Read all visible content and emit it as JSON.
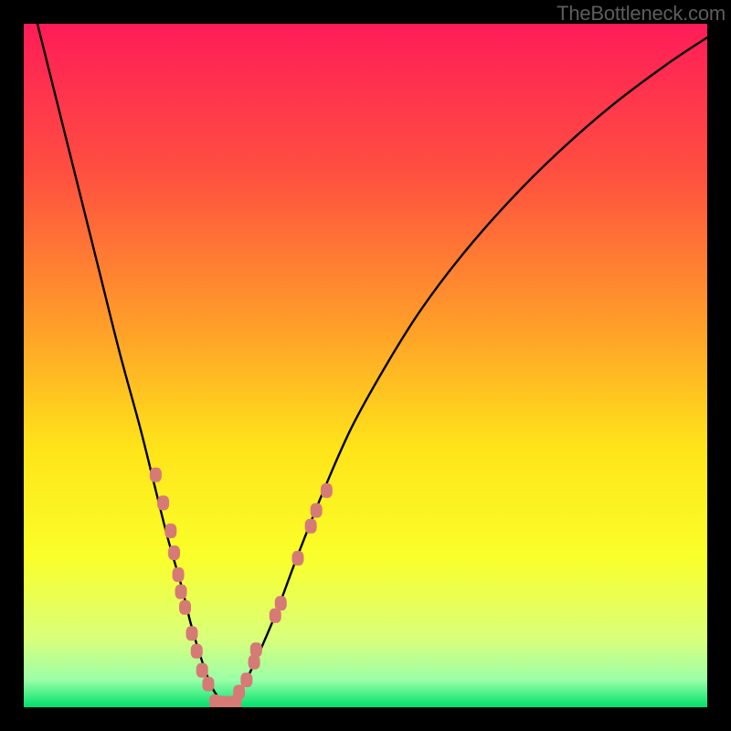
{
  "watermark": "TheBottleneck.com",
  "colors": {
    "frame": "#000000",
    "gradient_stops": [
      {
        "offset": 0.0,
        "color": "#ff1c58"
      },
      {
        "offset": 0.22,
        "color": "#ff5040"
      },
      {
        "offset": 0.45,
        "color": "#ffa128"
      },
      {
        "offset": 0.62,
        "color": "#ffe41a"
      },
      {
        "offset": 0.78,
        "color": "#faff2a"
      },
      {
        "offset": 0.9,
        "color": "#d9ff7b"
      },
      {
        "offset": 0.96,
        "color": "#9bffa8"
      },
      {
        "offset": 1.0,
        "color": "#00e06c"
      }
    ],
    "curve": "#000000",
    "marker": "#d67a76"
  },
  "chart_data": {
    "type": "line",
    "title": "",
    "xlabel": "",
    "ylabel": "",
    "xlim": [
      0,
      100
    ],
    "ylim": [
      0,
      100
    ],
    "grid": false,
    "series": [
      {
        "name": "bottleneck-curve",
        "x": [
          2,
          5,
          8,
          11,
          14,
          17,
          19,
          21,
          23,
          24.5,
          26,
          27.5,
          29,
          30.5,
          32,
          34,
          37,
          40,
          44,
          48,
          53,
          58,
          64,
          71,
          78,
          86,
          94,
          100
        ],
        "y": [
          100,
          88,
          76,
          64,
          52,
          41,
          33,
          25,
          18,
          12,
          7,
          3,
          1,
          1,
          3,
          7,
          14,
          22,
          32,
          41,
          50,
          58,
          66,
          74,
          81,
          88,
          94,
          98
        ]
      }
    ],
    "highlight_markers": {
      "name": "threshold-markers",
      "points": [
        {
          "x": 19.3,
          "y": 34.0
        },
        {
          "x": 20.4,
          "y": 29.9
        },
        {
          "x": 21.5,
          "y": 25.8
        },
        {
          "x": 22.0,
          "y": 22.6
        },
        {
          "x": 22.6,
          "y": 19.4
        },
        {
          "x": 23.0,
          "y": 16.9
        },
        {
          "x": 23.6,
          "y": 14.6
        },
        {
          "x": 24.6,
          "y": 10.8
        },
        {
          "x": 25.3,
          "y": 8.2
        },
        {
          "x": 26.1,
          "y": 5.4
        },
        {
          "x": 27.0,
          "y": 3.4
        },
        {
          "x": 28.0,
          "y": 0.8
        },
        {
          "x": 29.0,
          "y": 0.6
        },
        {
          "x": 30.0,
          "y": 0.6
        },
        {
          "x": 31.0,
          "y": 0.7
        },
        {
          "x": 31.5,
          "y": 2.2
        },
        {
          "x": 32.6,
          "y": 4.0
        },
        {
          "x": 33.7,
          "y": 6.6
        },
        {
          "x": 34.0,
          "y": 8.4
        },
        {
          "x": 36.8,
          "y": 13.4
        },
        {
          "x": 37.6,
          "y": 15.2
        },
        {
          "x": 40.1,
          "y": 21.8
        },
        {
          "x": 42.0,
          "y": 26.5
        },
        {
          "x": 42.8,
          "y": 28.8
        },
        {
          "x": 44.3,
          "y": 31.7
        }
      ]
    }
  }
}
